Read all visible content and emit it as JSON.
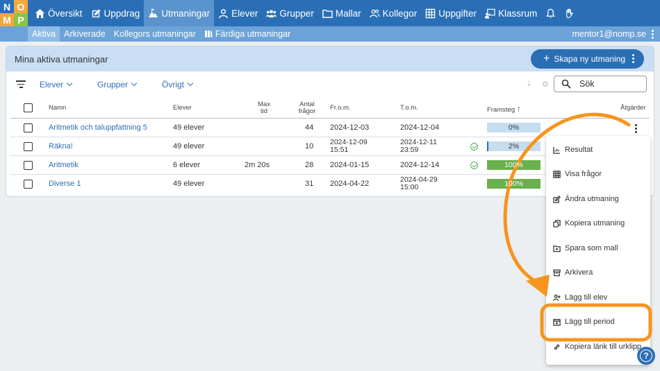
{
  "logo": {
    "letters": [
      "N",
      "O",
      "M",
      "P"
    ]
  },
  "topnav": {
    "items": [
      {
        "label": "Översikt",
        "icon": "home-icon"
      },
      {
        "label": "Uppdrag",
        "icon": "edit-icon"
      },
      {
        "label": "Utmaningar",
        "icon": "mountain-icon",
        "active": true
      },
      {
        "label": "Elever",
        "icon": "user-icon"
      },
      {
        "label": "Grupper",
        "icon": "users-icon"
      },
      {
        "label": "Mallar",
        "icon": "folder-icon"
      },
      {
        "label": "Kollegor",
        "icon": "colleagues-icon"
      },
      {
        "label": "Uppgifter",
        "icon": "grid-icon"
      },
      {
        "label": "Klassrum",
        "icon": "classroom-icon"
      },
      {
        "label": "",
        "icon": "bell-icon"
      },
      {
        "label": "",
        "icon": "hand-icon"
      }
    ]
  },
  "subnav": {
    "items": [
      {
        "label": "Aktiva",
        "active": true
      },
      {
        "label": "Arkiverade"
      },
      {
        "label": "Kollegors utmaningar"
      },
      {
        "label": "Färdiga utmaningar",
        "icon": "book-icon"
      }
    ],
    "user_email": "mentor1@nomp.se"
  },
  "card": {
    "title": "Mina aktiva utmaningar",
    "create_label": "Skapa ny utmaning",
    "filters": {
      "elever": "Elever",
      "grupper": "Grupper",
      "ovrigt": "Övrigt"
    },
    "search_placeholder": "Sök"
  },
  "table": {
    "headers": {
      "namn": "Namn",
      "elever": "Elever",
      "max_tid": "Max tid",
      "antal": "Antal frågor",
      "from": "Fr.o.m.",
      "tom": "T.o.m.",
      "framsteg": "Framsteg",
      "framsteg_sort": "↑",
      "atgarder": "Åtgärder"
    },
    "rows": [
      {
        "name": "Aritmetik och taluppfattning 5",
        "students": "49 elever",
        "max_time": "",
        "questions": "44",
        "from": "2024-12-03",
        "to": "2024-12-04",
        "done": false,
        "progress_label": "0%",
        "progress": 0
      },
      {
        "name": "Räkna!",
        "students": "49 elever",
        "max_time": "",
        "questions": "10",
        "from": "2024-12-09 15:51",
        "to": "2024-12-11 23:59",
        "done": true,
        "progress_label": "2%",
        "progress": 0.02
      },
      {
        "name": "Aritmetik",
        "students": "6 elever",
        "max_time": "2m 20s",
        "questions": "28",
        "from": "2024-01-15",
        "to": "2024-12-14",
        "done": true,
        "progress_label": "100%",
        "progress": 1
      },
      {
        "name": "Diverse 1",
        "students": "49 elever",
        "max_time": "",
        "questions": "31",
        "from": "2024-04-22",
        "to": "2024-04-29 15:00",
        "done": false,
        "progress_label": "100%",
        "progress": 1
      }
    ]
  },
  "menu": {
    "items": [
      {
        "label": "Resultat",
        "icon": "chart-icon"
      },
      {
        "label": "Visa frågor",
        "icon": "table-icon"
      },
      {
        "label": "Ändra utmaning",
        "icon": "pencil-icon"
      },
      {
        "label": "Kopiera utmaning",
        "icon": "copy-icon"
      },
      {
        "label": "Spara som mall",
        "icon": "folder-plus-icon"
      },
      {
        "label": "Arkivera",
        "icon": "archive-icon"
      },
      {
        "label": "Lägg till elev",
        "icon": "user-plus-icon"
      },
      {
        "label": "Lägg till period",
        "icon": "calendar-plus-icon"
      },
      {
        "label": "Kopiera länk till urklipp",
        "icon": "link-icon"
      }
    ]
  },
  "help": {
    "label": "?"
  },
  "colors": {
    "primary": "#2a6fb5",
    "subnav": "#6ba2d8",
    "header": "#c9def4",
    "progress_full": "#6ab04c",
    "highlight": "#f7941d"
  }
}
